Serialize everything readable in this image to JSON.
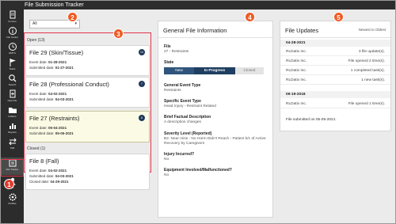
{
  "app": {
    "title": "File Submission Tracker"
  },
  "nav": {
    "items": [
      {
        "label": "Forums",
        "icon": "document-icon"
      },
      {
        "label": "Info Center",
        "icon": "info-icon"
      },
      {
        "label": "RMTS",
        "icon": "clock-icon"
      },
      {
        "label": "Tasks",
        "icon": "flag-icon"
      },
      {
        "label": "Search",
        "icon": "search-icon"
      },
      {
        "label": "New File",
        "icon": "new-file-icon"
      },
      {
        "label": "Folders",
        "icon": "folder-icon"
      },
      {
        "label": "Reports",
        "icon": "reports-icon"
      },
      {
        "label": "TAB",
        "icon": "transfer-icon"
      },
      {
        "label": "File Tracker",
        "icon": "file-tracker-icon"
      },
      {
        "label": "AR",
        "icon": "user-icon"
      },
      {
        "label": "Profiles",
        "icon": "settings-icon"
      }
    ]
  },
  "callouts": [
    "1",
    "2",
    "3",
    "4",
    "5"
  ],
  "list": {
    "filter_value": "All",
    "open_header": "Open (13)",
    "closed_header": "Closed (1)",
    "open_cards": [
      {
        "title": "File 29 (Skin/Tissue)",
        "count": "14",
        "l1_label": "Event date:",
        "l1_value": "01-28-2021",
        "l2_label": "Submitted date:",
        "l2_value": "01-27-2021"
      },
      {
        "title": "File 28 (Professional Conduct)",
        "count": "7",
        "l1_label": "Event date:",
        "l1_value": "04-02-2021",
        "l2_label": "Submitted date:",
        "l2_value": "04-03-2021"
      },
      {
        "title": "File 27 (Restraints)",
        "count": "6",
        "l1_label": "Event date:",
        "l1_value": "05-04-2021",
        "l2_label": "Submitted date:",
        "l2_value": "05-05-2021"
      }
    ],
    "closed_card": {
      "title": "File 8 (Fall)",
      "l1_label": "Event date:",
      "l1_value": "04-02-2021",
      "l2_label": "Submitted date:",
      "l2_value": "04-03-2021",
      "l3_label": "Closed date:",
      "l3_value": "04-29-2021"
    }
  },
  "info": {
    "title": "General File Information",
    "file_label": "File",
    "file_value": "27 - Restraints",
    "state_label": "State",
    "states": [
      "New",
      "In Progress",
      "Closed"
    ],
    "general_type_label": "General Event Type",
    "general_type_value": "Restraints",
    "specific_type_label": "Specific Event Type",
    "specific_type_value": "Head Injury - Restraint Related",
    "brief_label": "Brief Factual Description",
    "brief_value": "A description changes",
    "severity_label": "Severity Level (Reported)",
    "severity_value": "B2. Near miss - No Harm Didn't Reach - Patient b/c of Active Recovery by Caregivers",
    "injury_label": "Injury Incurred?",
    "injury_value": "No",
    "equip_label": "Equipment Involved/Malfunctioned?",
    "equip_value": "No"
  },
  "updates": {
    "title": "File Updates",
    "sort": "Newest to Oldest",
    "groups": [
      {
        "date": "04-28-2021",
        "rows": [
          {
            "who": "RLDatix Inc.",
            "what": "3 file update(s)."
          },
          {
            "who": "RLDatix Inc.",
            "what": "File opened 2 time(s)."
          },
          {
            "who": "RLDatix Inc.",
            "what": "1 completed task(s)."
          },
          {
            "who": "RLDatix Inc.",
            "what": "1 new task(s)."
          }
        ]
      },
      {
        "date": "09-19-2018",
        "rows": [
          {
            "who": "RLDatix Inc.",
            "what": "File opened 1 time(s)."
          }
        ]
      }
    ],
    "footer": "File submitted on 05-05-2021."
  },
  "colors": {
    "accent": "#1f3f62",
    "callout_red": "#e03c2d",
    "callout_orange": "#ef5a24",
    "selection": "#fbfbe5"
  }
}
